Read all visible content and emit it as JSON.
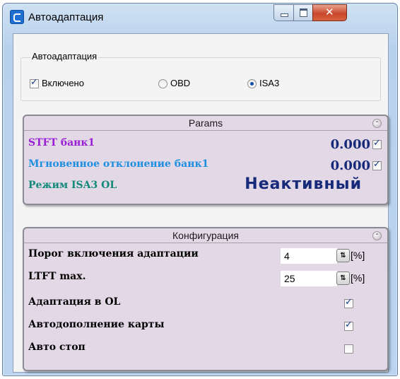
{
  "window": {
    "title": "Автоадаптация"
  },
  "autoadapt": {
    "group_label": "Автоадаптация",
    "enabled_label": "Включено",
    "enabled_checked": true,
    "mode_options": [
      "OBD",
      "ISA3"
    ],
    "mode_selected": "ISA3"
  },
  "params": {
    "header": "Params",
    "rows": [
      {
        "label": "STFT банк1",
        "value": "0.000",
        "checked": true,
        "color": "#9a1fd6"
      },
      {
        "label": "Мгновенное отклонение банк1",
        "value": "0.000",
        "checked": true,
        "color": "#1e8fe0"
      },
      {
        "label": "Режим ISA3 OL",
        "value": "Неактивный",
        "color": "#138a7a"
      }
    ]
  },
  "config": {
    "header": "Конфигурация",
    "rows": [
      {
        "label": "Порог включения адаптации",
        "value": "4",
        "unit": "[%]"
      },
      {
        "label": "LTFT max.",
        "value": "25",
        "unit": "[%]"
      },
      {
        "label": "Адаптация в OL",
        "checked": true
      },
      {
        "label": "Автодополнение карты",
        "checked": true
      },
      {
        "label": "Авто стоп",
        "checked": false
      }
    ]
  },
  "colors": {
    "panel_bg": "#e2d8e6",
    "value_blue": "#172a7a",
    "titlebar": "#bcd4ee",
    "close_button": "#c9472d"
  }
}
